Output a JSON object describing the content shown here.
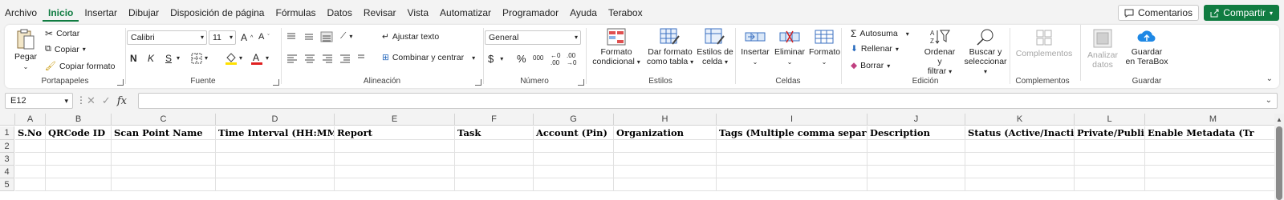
{
  "menu": {
    "items": [
      "Archivo",
      "Inicio",
      "Insertar",
      "Dibujar",
      "Disposición de página",
      "Fórmulas",
      "Datos",
      "Revisar",
      "Vista",
      "Automatizar",
      "Programador",
      "Ayuda",
      "Terabox"
    ],
    "active_index": 1,
    "comments_label": "Comentarios",
    "share_label": "Compartir"
  },
  "ribbon": {
    "portapapeles": {
      "label": "Portapapeles",
      "paste": "Pegar",
      "cut": "Cortar",
      "copy": "Copiar",
      "format_painter": "Copiar formato"
    },
    "fuente": {
      "label": "Fuente",
      "font_name": "Calibri",
      "font_size": "11",
      "bold": "N",
      "italic": "K",
      "underline": "S"
    },
    "alineacion": {
      "label": "Alineación",
      "wrap": "Ajustar texto",
      "merge": "Combinar y centrar"
    },
    "numero": {
      "label": "Número",
      "format": "General",
      "currency": "$",
      "percent": "%",
      "thousands": "000"
    },
    "estilos": {
      "label": "Estilos",
      "conditional": [
        "Formato",
        "condicional"
      ],
      "table": [
        "Dar formato",
        "como tabla"
      ],
      "cell_styles": [
        "Estilos de",
        "celda"
      ]
    },
    "celdas": {
      "label": "Celdas",
      "insert": "Insertar",
      "delete": "Eliminar",
      "format": "Formato"
    },
    "edicion": {
      "label": "Edición",
      "autosum": "Autosuma",
      "fill": "Rellenar",
      "clear": "Borrar",
      "sort": [
        "Ordenar y",
        "filtrar"
      ],
      "find": [
        "Buscar y",
        "seleccionar"
      ]
    },
    "complementos": {
      "label": "Complementos",
      "addins": "Complementos",
      "analyze": [
        "Analizar",
        "datos"
      ]
    },
    "guardar": {
      "label": "Guardar",
      "terabox": [
        "Guardar",
        "en TeraBox"
      ]
    }
  },
  "formula_bar": {
    "name_box": "E12",
    "fx": "fx",
    "value": ""
  },
  "grid": {
    "columns": [
      "A",
      "B",
      "C",
      "D",
      "E",
      "F",
      "G",
      "H",
      "I",
      "J",
      "K",
      "L",
      "M"
    ],
    "rows": [
      "1",
      "2",
      "3",
      "4",
      "5"
    ],
    "headers": [
      "S.No",
      "QRCode ID",
      "Scan Point Name",
      "Time Interval (HH:MM)",
      "Report",
      "Task",
      "Account (Pin)",
      "Organization",
      "Tags (Multiple comma separated",
      "Description",
      "Status (Active/Inactive)",
      "Private/Public",
      "Enable Metadata (Tr"
    ]
  },
  "colors": {
    "accent": "#107c41",
    "font_color_bar": "#e02020",
    "highlight_bar": "#ffe000"
  }
}
